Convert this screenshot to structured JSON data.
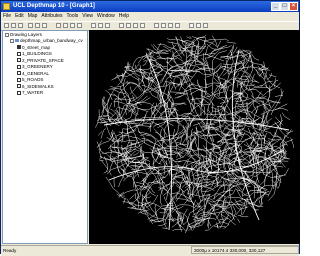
{
  "window": {
    "title": "UCL Depthmap 10 - [Graph1]"
  },
  "menu": [
    "File",
    "Edit",
    "Map",
    "Attributes",
    "Tools",
    "View",
    "Window",
    "Help"
  ],
  "tree": {
    "root": "Drawing Layers",
    "group": "depthmap_urban_bandway_cv",
    "layers": [
      "0_street_map",
      "1_BUILDINGS",
      "2_PRIVATE_SPACE",
      "3_GREENERY",
      "4_GENERAL",
      "5_ROADS",
      "6_SIDEWALKS",
      "7_WATER"
    ]
  },
  "status": {
    "ready": "Ready",
    "coords": "3000µ x 10174.4     330,000, 330,127"
  },
  "colors": {
    "titlebar": "#0a3dbf",
    "map_background": "#000000",
    "map_lines": "#ffffff"
  }
}
